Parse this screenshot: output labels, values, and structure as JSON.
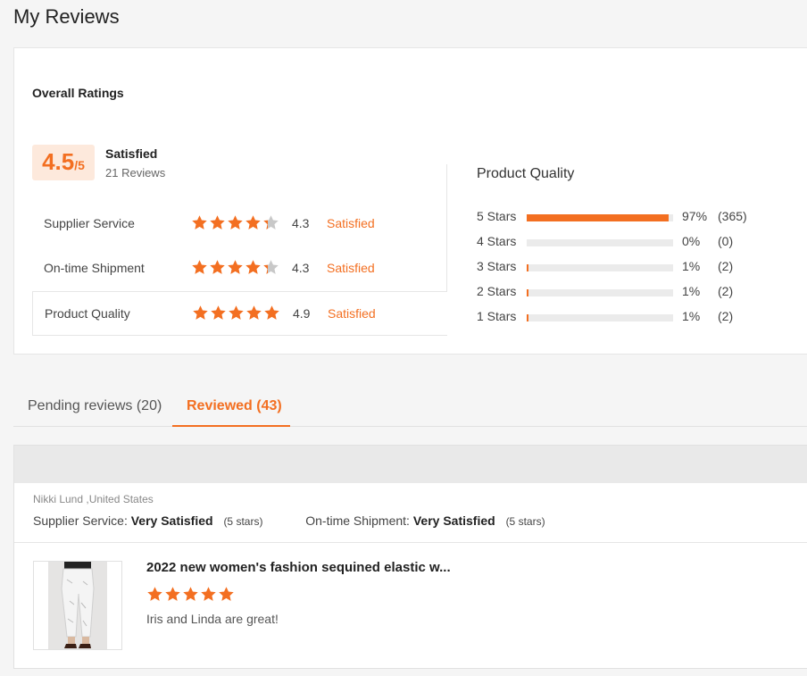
{
  "page": {
    "title": "My Reviews"
  },
  "overall": {
    "heading": "Overall Ratings",
    "score": "4.5",
    "denominator": "/5",
    "status": "Satisfied",
    "reviews_count": "21 Reviews",
    "rows": [
      {
        "label": "Supplier Service",
        "stars": 4.3,
        "score": "4.3",
        "status": "Satisfied"
      },
      {
        "label": "On-time Shipment",
        "stars": 4.3,
        "score": "4.3",
        "status": "Satisfied"
      },
      {
        "label": "Product Quality",
        "stars": 4.9,
        "score": "4.9",
        "status": "Satisfied"
      }
    ]
  },
  "product_quality": {
    "title": "Product Quality",
    "distribution": [
      {
        "label": "5  Stars",
        "fraction": 0.97,
        "pct": "97%",
        "count": "(365)"
      },
      {
        "label": "4  Stars",
        "fraction": 0.0,
        "pct": "0%",
        "count": "(0)"
      },
      {
        "label": "3  Stars",
        "fraction": 0.01,
        "pct": "1%",
        "count": "(2)"
      },
      {
        "label": "2  Stars",
        "fraction": 0.01,
        "pct": "1%",
        "count": "(2)"
      },
      {
        "label": "1  Stars",
        "fraction": 0.01,
        "pct": "1%",
        "count": "(2)"
      }
    ]
  },
  "tabs": [
    {
      "label": "Pending reviews (20)"
    },
    {
      "label": "Reviewed (43)"
    }
  ],
  "review": {
    "reviewer": "Nikki Lund ,United States",
    "supplier_label": "Supplier Service:",
    "supplier_value": "Very Satisfied",
    "supplier_stars": "(5 stars)",
    "shipment_label": "On-time Shipment:",
    "shipment_value": "Very Satisfied",
    "shipment_stars": "(5 stars)",
    "product_title": "2022 new women's fashion sequined elastic w...",
    "rating": 5,
    "text": "Iris and Linda are great!"
  },
  "colors": {
    "accent": "#f36f21",
    "star_empty": "#c8c8c8"
  }
}
